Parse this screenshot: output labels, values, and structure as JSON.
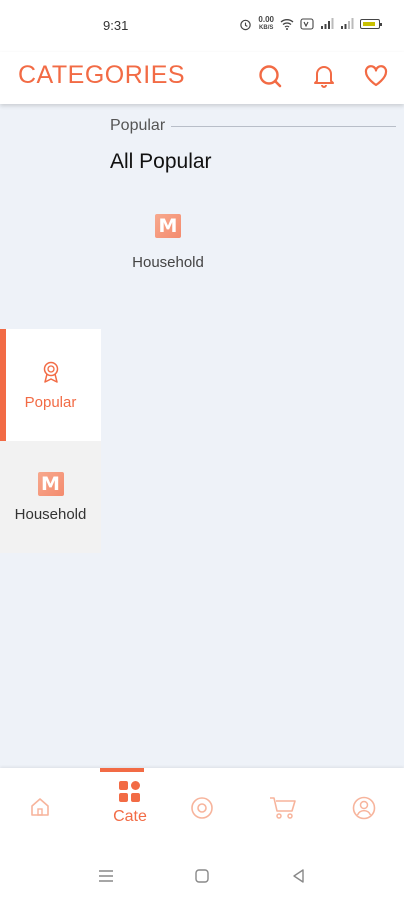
{
  "status_bar": {
    "time": "9:31",
    "net_speed_value": "0.00",
    "net_speed_unit": "KB/S"
  },
  "header": {
    "title": "CATEGORIES",
    "accent_color": "#f26b45",
    "icons": [
      "search-icon",
      "bell-icon",
      "heart-icon"
    ]
  },
  "sidebar": {
    "items": [
      {
        "label": "Popular",
        "icon": "award-icon",
        "active": true
      },
      {
        "label": "Household",
        "icon": "brand-m-logo",
        "active": false
      }
    ]
  },
  "main": {
    "section_label": "Popular",
    "section_title": "All Popular",
    "categories": [
      {
        "label": "Household",
        "icon": "brand-m-logo"
      }
    ]
  },
  "bottom_nav": {
    "items": [
      {
        "icon": "home-icon",
        "label": ""
      },
      {
        "icon": "grid-icon",
        "label": "Cate",
        "active": true
      },
      {
        "icon": "compass-icon",
        "label": ""
      },
      {
        "icon": "cart-icon",
        "label": ""
      },
      {
        "icon": "user-icon",
        "label": ""
      }
    ]
  },
  "system_nav": {
    "icons": [
      "menu-icon",
      "square-home-icon",
      "back-triangle-icon"
    ]
  }
}
